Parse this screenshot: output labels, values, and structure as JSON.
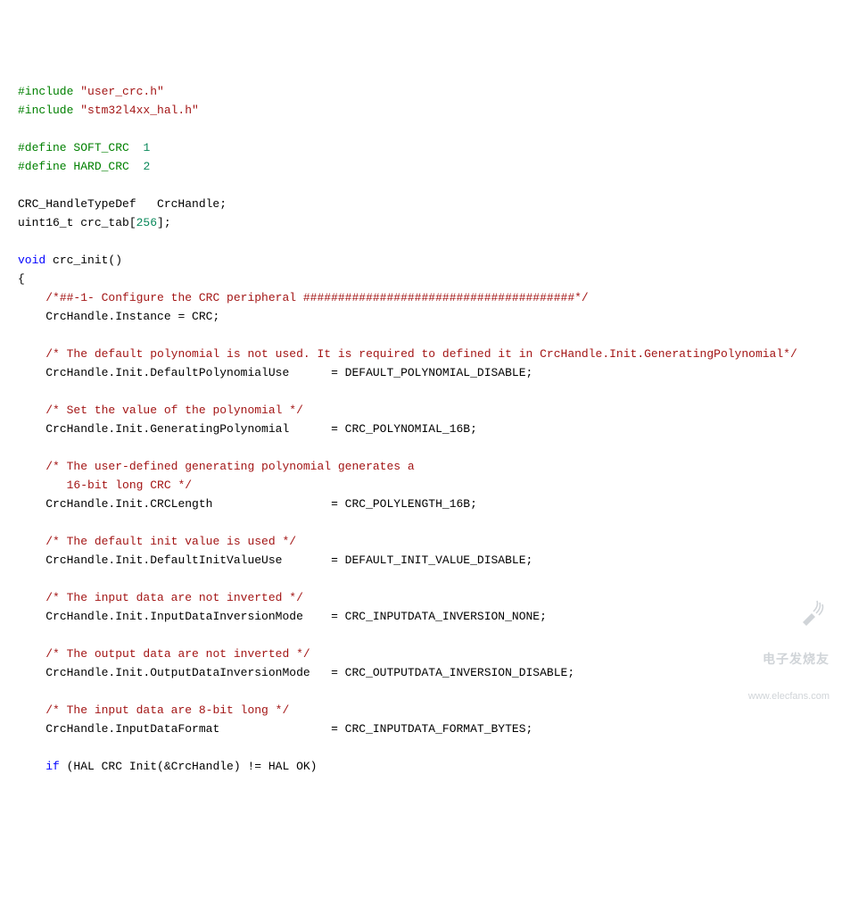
{
  "code": {
    "include1_directive": "#include ",
    "include1_file": "\"user_crc.h\"",
    "include2_directive": "#include ",
    "include2_file": "\"stm32l4xx_hal.h\"",
    "define1_a": "#define",
    "define1_b": " SOFT_CRC  ",
    "define1_val": "1",
    "define2_a": "#define",
    "define2_b": " HARD_CRC  ",
    "define2_val": "2",
    "decl1": "CRC_HandleTypeDef   CrcHandle;",
    "decl2a": "uint16_t crc_tab[",
    "decl2num": "256",
    "decl2b": "];",
    "fn_kw": "void",
    "fn_rest": " crc_init()",
    "brace_open": "{",
    "cmt_configure": "/*##-1- Configure the CRC peripheral #######################################*/",
    "line_instance": "CrcHandle.Instance = CRC;",
    "cmt_defpoly": "/* The default polynomial is not used. It is required to defined it in CrcHandle.Init.GeneratingPolynomial*/",
    "line_defpoly": "CrcHandle.Init.DefaultPolynomialUse      = DEFAULT_POLYNOMIAL_DISABLE;",
    "cmt_setpoly": "/* Set the value of the polynomial */",
    "line_setpoly": "CrcHandle.Init.GeneratingPolynomial      = CRC_POLYNOMIAL_16B;",
    "cmt_userdef1": "/* The user-defined generating polynomial generates a",
    "cmt_userdef2": "   16-bit long CRC */",
    "line_crclen": "CrcHandle.Init.CRCLength                 = CRC_POLYLENGTH_16B;",
    "cmt_definit": "/* The default init value is used */",
    "line_definit": "CrcHandle.Init.DefaultInitValueUse       = DEFAULT_INIT_VALUE_DISABLE;",
    "cmt_inputinv": "/* The input data are not inverted */",
    "line_inputinv": "CrcHandle.Init.InputDataInversionMode    = CRC_INPUTDATA_INVERSION_NONE;",
    "cmt_outputinv": "/* The output data are not inverted */",
    "line_outputinv": "CrcHandle.Init.OutputDataInversionMode   = CRC_OUTPUTDATA_INVERSION_DISABLE;",
    "cmt_8bit": "/* The input data are 8-bit long */",
    "line_format": "CrcHandle.InputDataFormat                = CRC_INPUTDATA_FORMAT_BYTES;",
    "if_kw": "if",
    "if_rest": " (HAL CRC Init(&CrcHandle) != HAL OK)"
  },
  "watermark": {
    "title": "电子发烧友",
    "url": "www.elecfans.com"
  }
}
